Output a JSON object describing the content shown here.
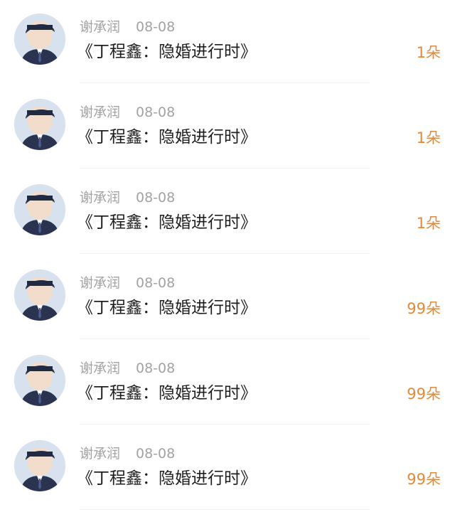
{
  "items": [
    {
      "name": "谢承润",
      "date": "08-08",
      "title": "《丁程鑫：隐婚进行时》",
      "count": "1朵"
    },
    {
      "name": "谢承润",
      "date": "08-08",
      "title": "《丁程鑫：隐婚进行时》",
      "count": "1朵"
    },
    {
      "name": "谢承润",
      "date": "08-08",
      "title": "《丁程鑫：隐婚进行时》",
      "count": "1朵"
    },
    {
      "name": "谢承润",
      "date": "08-08",
      "title": "《丁程鑫：隐婚进行时》",
      "count": "99朵"
    },
    {
      "name": "谢承润",
      "date": "08-08",
      "title": "《丁程鑫：隐婚进行时》",
      "count": "99朵"
    },
    {
      "name": "谢承润",
      "date": "08-08",
      "title": "《丁程鑫：隐婚进行时》",
      "count": "99朵"
    }
  ],
  "colors": {
    "meta_text": "#a3a3a3",
    "title_text": "#1f1f1f",
    "count_text": "#e28a3a",
    "divider": "#f0f0f0"
  }
}
